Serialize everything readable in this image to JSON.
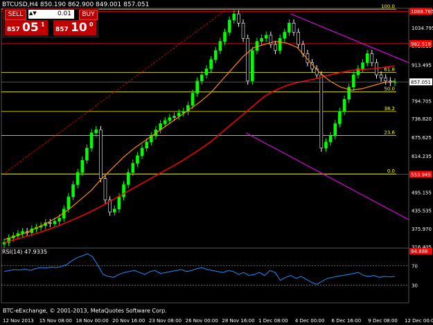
{
  "header": {
    "title": "BTCUSD,H4  850.190 862.900 849.001 857.051"
  },
  "trade_panel": {
    "sell_label": "SELL",
    "buy_label": "BUY",
    "lot_value": "0.01",
    "sell_price_prefix": "857",
    "sell_price_big": "05",
    "sell_price_sup": "1",
    "buy_price_prefix": "857",
    "buy_price_big": "10",
    "buy_price_sup": "0"
  },
  "colors": {
    "background": "#000000",
    "bull_candle": "#00ff00",
    "bear_candle": "#ffffff",
    "ma_slow": "#ff0000",
    "ma_fast": "#ff8c00",
    "channel": "#ff00ff",
    "fib": "#ffff00",
    "level_red": "#ff0000",
    "rsi": "#1e90ff"
  },
  "chart_data": {
    "type": "candlestick",
    "symbol": "BTCUSD",
    "timeframe": "H4",
    "ylim": [
      316.405,
      1093.865
    ],
    "price_axis": [
      "1034.795",
      "975.910",
      "913.495",
      "857.051",
      "794.705",
      "736.820",
      "675.625",
      "614.235",
      "555.650",
      "495.155",
      "435.535",
      "375.970",
      "316.405"
    ],
    "price_axis_values": [
      1034.795,
      975.91,
      913.495,
      857.051,
      794.705,
      736.82,
      675.625,
      614.235,
      555.65,
      495.155,
      435.535,
      375.97,
      316.405
    ],
    "time_axis": [
      "12 Nov 2013",
      "15 Nov 08:00",
      "18 Nov 00:00",
      "20 Nov 16:00",
      "23 Nov 08:00",
      "26 Nov 00:00",
      "28 Nov 16:00",
      "1 Dec 08:00",
      "4 Dec 00:00",
      "6 Dec 16:00",
      "9 Dec 08:00",
      "12 Dec 00:00"
    ],
    "red_levels": [
      {
        "label": "1088.765",
        "value": 1088.765
      },
      {
        "label": "982.519",
        "value": 982.519
      },
      {
        "label": "553.945",
        "value": 553.945
      }
    ],
    "fib_levels": [
      {
        "label": "100.0",
        "value": 1095.5
      },
      {
        "label": "61.8",
        "value": 888.1
      },
      {
        "label": "50.0",
        "value": 824.0
      },
      {
        "label": "38.2",
        "value": 760.0
      },
      {
        "label": "23.6",
        "value": 681.5
      },
      {
        "label": "0.0",
        "value": 555.0
      }
    ],
    "current_price": "857.051",
    "current_price_value": 857.051,
    "close_series": [
      330,
      345,
      352,
      360,
      366,
      362,
      375,
      380,
      385,
      395,
      392,
      400,
      410,
      440,
      480,
      520,
      560,
      600,
      640,
      690,
      700,
      540,
      470,
      430,
      440,
      480,
      520,
      560,
      590,
      615,
      640,
      660,
      680,
      700,
      720,
      730,
      740,
      745,
      755,
      760,
      780,
      820,
      860,
      880,
      900,
      930,
      960,
      990,
      1020,
      1060,
      1080,
      1050,
      1000,
      860,
      960,
      990,
      1000,
      1010,
      980,
      960,
      1000,
      1020,
      1050,
      1020,
      980,
      950,
      920,
      900,
      880,
      640,
      660,
      680,
      720,
      760,
      800,
      840,
      880,
      900,
      920,
      950,
      920,
      880,
      870,
      860,
      855,
      857
    ],
    "ma_slow": [
      330,
      340,
      350,
      360,
      372,
      385,
      400,
      415,
      432,
      450,
      470,
      490,
      510,
      530,
      550,
      570,
      590,
      612,
      635,
      660,
      690,
      720,
      750,
      780,
      810,
      830,
      845,
      855,
      862,
      870,
      880,
      888,
      895,
      898,
      900,
      905,
      910
    ],
    "ma_fast": [
      340,
      350,
      362,
      378,
      395,
      415,
      440,
      470,
      500,
      540,
      575,
      610,
      640,
      665,
      690,
      715,
      740,
      765,
      790,
      820,
      860,
      900,
      940,
      970,
      980,
      990,
      985,
      970,
      930,
      890,
      860,
      840,
      830,
      835,
      845,
      855,
      860
    ],
    "rsi": {
      "label": "RSI(14) 47.9335",
      "ylim": [
        0,
        100
      ],
      "levels": [
        {
          "label": "70",
          "value": 70
        },
        {
          "label": "30",
          "value": 30
        }
      ],
      "top_tag": "94.888",
      "values": [
        58,
        60,
        62,
        61,
        63,
        60,
        64,
        66,
        65,
        67,
        66,
        68,
        72,
        80,
        86,
        90,
        94,
        88,
        70,
        52,
        48,
        46,
        52,
        56,
        58,
        60,
        56,
        52,
        58,
        60,
        54,
        56,
        58,
        60,
        62,
        58,
        60,
        64,
        66,
        62,
        60,
        58,
        56,
        60,
        58,
        52,
        56,
        50,
        52,
        56,
        50,
        60,
        56,
        40,
        46,
        50,
        44,
        48,
        42,
        36,
        32,
        38,
        44,
        46,
        48,
        50,
        52,
        54,
        56,
        50,
        48,
        50,
        46,
        48,
        47,
        48
      ]
    }
  },
  "footer": {
    "copyright": "BTC-eExchange, © 2001-2013, MetaQuotes Software Corp."
  }
}
